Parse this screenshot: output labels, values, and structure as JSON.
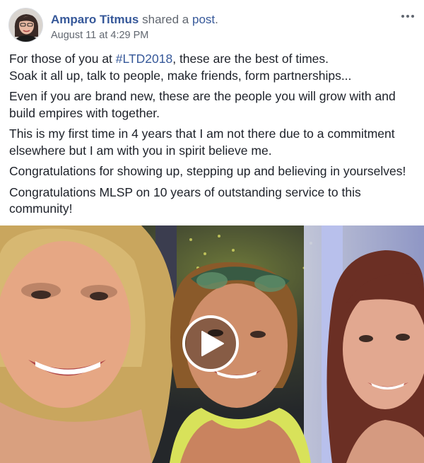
{
  "post": {
    "author": "Amparo Titmus",
    "shared_text": "shared a",
    "post_link": "post",
    "period": ".",
    "timestamp": "August 11 at 4:29 PM",
    "paragraphs": [
      {
        "pre": "For those of you at ",
        "hashtag": "#LTD2018",
        "post": ", these are the best of times.",
        "line2": "Soak it all up, talk to people, make friends, form partnerships..."
      },
      {
        "line1": "Even if you are brand new, these are the people you will grow with and",
        "line2": "build empires with together."
      },
      {
        "line1": "This is my first time in 4 years that I am not there due to a commitment",
        "line2": "elsewhere but I am with you in spirit believe me."
      },
      {
        "line1": "Congratulations for showing up, stepping up and believing in yourselves!"
      },
      {
        "line1": "Congratulations MLSP on 10 years of outstanding service to this",
        "line2": "community!"
      }
    ]
  },
  "icons": {
    "more": "more-options-icon",
    "play": "play-icon"
  },
  "colors": {
    "link": "#365899",
    "text": "#1d2129",
    "meta": "#616770"
  }
}
